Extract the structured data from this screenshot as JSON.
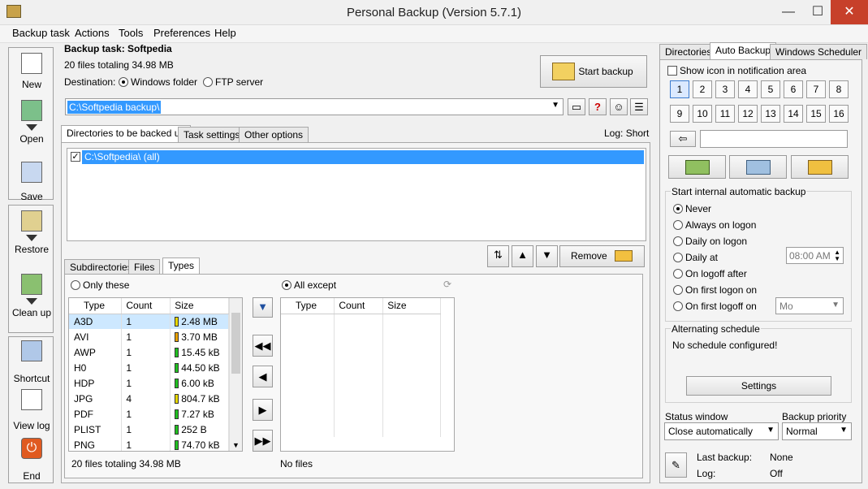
{
  "window": {
    "title": "Personal Backup (Version 5.7.1)",
    "min": "—",
    "max": "☐",
    "close": "✕"
  },
  "menu": [
    "Backup task",
    "Actions",
    "Tools",
    "Preferences",
    "Help"
  ],
  "toolbar": {
    "new": "New",
    "open": "Open",
    "save": "Save",
    "restore": "Restore",
    "cleanup": "Clean up",
    "shortcut": "Shortcut",
    "viewlog": "View log",
    "end": "End"
  },
  "task": {
    "title": "Backup task: Softpedia",
    "summary": "20 files totaling 34.98 MB",
    "destination_label": "Destination:",
    "opt_windows": "Windows folder",
    "opt_ftp": "FTP server",
    "path": "C:\\Softpedia backup\\",
    "start_backup": "Start backup",
    "help": "?",
    "log": "Log: Short"
  },
  "tabs": [
    "Directories to be backed up",
    "Task settings",
    "Other options"
  ],
  "dirs": [
    "C:\\Softpedia\\ (all)"
  ],
  "remove": "Remove",
  "subtabs": [
    "Subdirectories",
    "Files",
    "Types"
  ],
  "types": {
    "only_these": "Only these",
    "all_except": "All except",
    "headers": [
      "Type",
      "Count",
      "Size"
    ],
    "rows": [
      {
        "type": "A3D",
        "count": "1",
        "size": "2.48 MB",
        "color": "#e8d800"
      },
      {
        "type": "AVI",
        "count": "1",
        "size": "3.70 MB",
        "color": "#e8a000"
      },
      {
        "type": "AWP",
        "count": "1",
        "size": "15.45  kB",
        "color": "#20c020"
      },
      {
        "type": "H0",
        "count": "1",
        "size": "44.50  kB",
        "color": "#20c020"
      },
      {
        "type": "HDP",
        "count": "1",
        "size": "6.00  kB",
        "color": "#20c020"
      },
      {
        "type": "JPG",
        "count": "4",
        "size": "804.7  kB",
        "color": "#e8d800"
      },
      {
        "type": "PDF",
        "count": "1",
        "size": "7.27  kB",
        "color": "#20c020"
      },
      {
        "type": "PLIST",
        "count": "1",
        "size": "252 B",
        "color": "#20c020"
      },
      {
        "type": "PNG",
        "count": "1",
        "size": "74.70  kB",
        "color": "#20c020"
      }
    ],
    "left_footer": "20 files totaling 34.98 MB",
    "right_footer": "No files"
  },
  "right": {
    "tabs": [
      "Directories",
      "Auto Backup",
      "Windows Scheduler"
    ],
    "show_icon": "Show icon in notification area",
    "numbers": [
      "1",
      "2",
      "3",
      "4",
      "5",
      "6",
      "7",
      "8",
      "9",
      "10",
      "11",
      "12",
      "13",
      "14",
      "15",
      "16"
    ],
    "auto_title": "Start internal automatic backup",
    "auto_opts": [
      "Never",
      "Always on logon",
      "Daily on logon",
      "Daily at",
      "On logoff after",
      "On first logon on",
      "On first logoff on"
    ],
    "time": "08:00 AM",
    "day": "Mo",
    "alt_title": "Alternating schedule",
    "alt_text": "No schedule configured!",
    "settings": "Settings",
    "status_label": "Status window",
    "status_value": "Close automatically",
    "priority_label": "Backup priority",
    "priority_value": "Normal",
    "last_backup_label": "Last backup:",
    "last_backup_value": "None",
    "log_label": "Log:",
    "log_value": "Off"
  }
}
